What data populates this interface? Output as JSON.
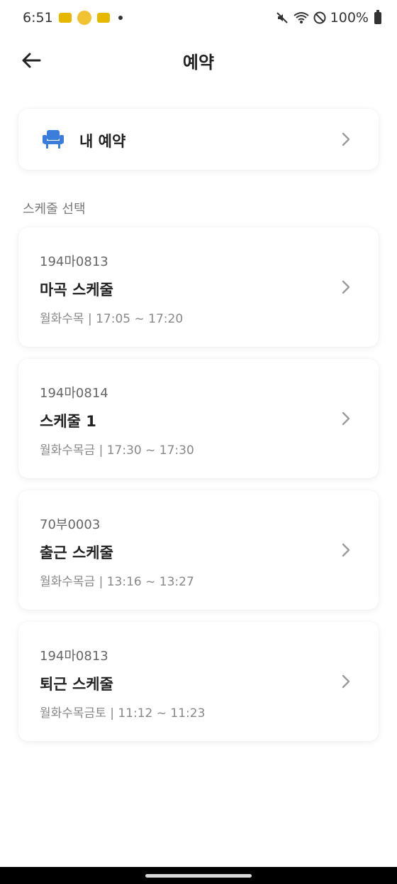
{
  "status_bar": {
    "time": "6:51",
    "battery": "100%"
  },
  "header": {
    "title": "예약"
  },
  "my_reservation": {
    "label": "내 예약"
  },
  "section": {
    "label": "스케줄 선택"
  },
  "schedules": [
    {
      "plate": "194마0813",
      "name": "마곡 스케줄",
      "time": "월화수목 | 17:05 ~ 17:20"
    },
    {
      "plate": "194마0814",
      "name": "스케줄 1",
      "time": "월화수목금 | 17:30 ~ 17:30"
    },
    {
      "plate": "70부0003",
      "name": "출근 스케줄",
      "time": "월화수목금 | 13:16 ~ 13:27"
    },
    {
      "plate": "194마0813",
      "name": "퇴근 스케줄",
      "time": "월화수목금토 | 11:12 ~ 11:23"
    }
  ],
  "colors": {
    "accent": "#3b7ddd",
    "chevron": "#9a9a9a"
  },
  "icons": {
    "back": "arrow-left-icon",
    "seat": "seat-icon",
    "chevron": "chevron-right-icon"
  }
}
